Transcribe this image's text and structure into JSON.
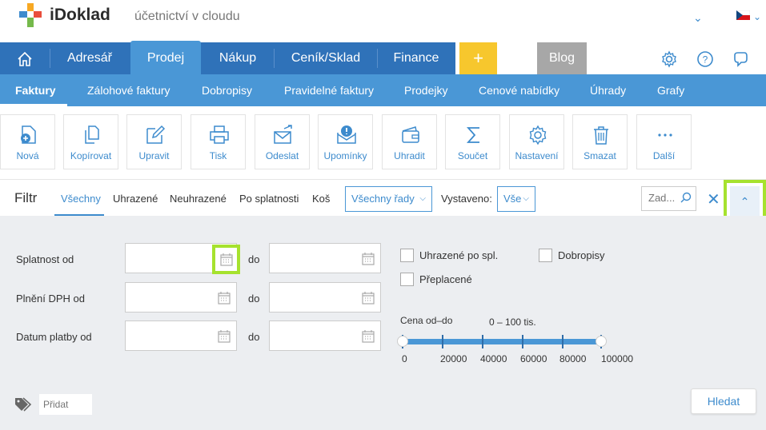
{
  "brand": {
    "name": "iDoklad",
    "tagline": "účetnictví v cloudu"
  },
  "main_nav": {
    "items": [
      "Adresář",
      "Prodej",
      "Nákup",
      "Ceník/Sklad",
      "Finance"
    ],
    "active": "Prodej",
    "plus": "+",
    "blog": "Blog"
  },
  "sub_nav": {
    "items": [
      "Faktury",
      "Zálohové faktury",
      "Dobropisy",
      "Pravidelné faktury",
      "Prodejky",
      "Cenové nabídky",
      "Úhrady",
      "Grafy"
    ],
    "active": "Faktury"
  },
  "toolbar": {
    "buttons": [
      "Nová",
      "Kopírovat",
      "Upravit",
      "Tisk",
      "Odeslat",
      "Upomínky",
      "Uhradit",
      "Součet",
      "Nastavení",
      "Smazat",
      "Další"
    ]
  },
  "filter": {
    "title": "Filtr",
    "tabs": [
      "Všechny",
      "Uhrazené",
      "Neuhrazené",
      "Po splatnosti",
      "Koš"
    ],
    "active_tab": "Všechny",
    "series_select": "Všechny řady",
    "issued_label": "Vystaveno:",
    "issued_select": "Vše",
    "search_placeholder": "Zad..."
  },
  "panel": {
    "date_rows": [
      "Splatnost od",
      "Plnění DPH od",
      "Datum platby od"
    ],
    "to_label": "do",
    "checkboxes": [
      "Uhrazené po spl.",
      "Dobropisy",
      "Přeplacené"
    ],
    "price": {
      "label": "Cena od–do",
      "value": "0 – 100 tis.",
      "ticks": [
        "0",
        "20000",
        "40000",
        "60000",
        "80000",
        "100000"
      ],
      "min": 0,
      "max": 100000
    },
    "tag_placeholder": "Přidat",
    "search_button": "Hledat"
  },
  "colors": {
    "primary": "#2f72b9",
    "secondary": "#4a97d6",
    "accent": "#f7c72d",
    "highlight": "#a6e22e"
  }
}
